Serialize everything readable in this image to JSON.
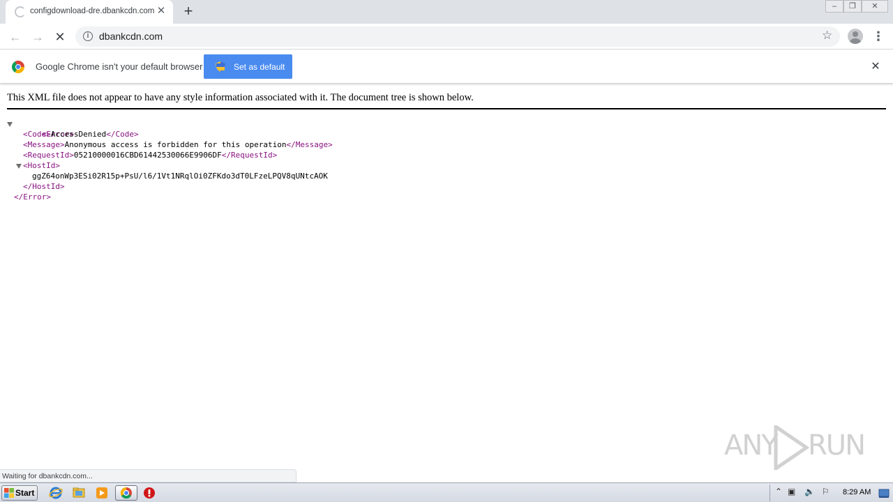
{
  "browser": {
    "tab": {
      "title": "configdownload-dre.dbankcdn.com",
      "close_glyph": "✕"
    },
    "new_tab_glyph": "+",
    "window_controls": {
      "minimize": "–",
      "maximize": "❐",
      "close": "✕"
    },
    "toolbar": {
      "back_glyph": "←",
      "forward_glyph": "→",
      "stop_glyph": "✕",
      "url": "dbankcdn.com",
      "info_glyph": "i",
      "star_glyph": "☆",
      "menu_glyph": "⋮"
    },
    "infobar": {
      "message": "Google Chrome isn't your default browser",
      "button_label": "Set as default",
      "close_glyph": "✕"
    },
    "status_text": "Waiting for dbankcdn.com..."
  },
  "page": {
    "notice": "This XML file does not appear to have any style information associated with it. The document tree is shown below.",
    "xml": {
      "error_open": "<Error>",
      "error_close": "</Error>",
      "code_open": "<Code>",
      "code_value": "AccessDenied",
      "code_close": "</Code>",
      "message_open": "<Message>",
      "message_value": "Anonymous access is forbidden for this operation",
      "message_close": "</Message>",
      "requestid_open": "<RequestId>",
      "requestid_value": "05210000016CBD61442530066E9906DF",
      "requestid_close": "</RequestId>",
      "hostid_open": "<HostId>",
      "hostid_value": "ggZ64onWp3ESi02R15p+PsU/l6/1Vt1NRqlOi0ZFKdo3dT0LFzeLPQV8qUNtcAOK",
      "hostid_close": "</HostId>"
    }
  },
  "watermark": {
    "left": "ANY",
    "right": "RUN"
  },
  "taskbar": {
    "start_label": "Start",
    "clock": "8:29 AM",
    "tray_glyphs": {
      "chevron": "⌃",
      "network": "▣",
      "volume": "🔈",
      "flag": "⚐"
    }
  },
  "colors": {
    "tab_strip": "#dee1e6",
    "xml_tag": "#881280",
    "set_default_button": "#4a8bf0",
    "opera_red": "#d01515"
  },
  "icons": [
    "chrome-logo-icon",
    "info-icon",
    "star-icon",
    "profile-icon",
    "menu-icon",
    "shield-icon",
    "close-icon",
    "internet-explorer-icon",
    "explorer-folder-icon",
    "media-player-icon",
    "chrome-icon",
    "opera-icon",
    "windows-flag-icon"
  ]
}
